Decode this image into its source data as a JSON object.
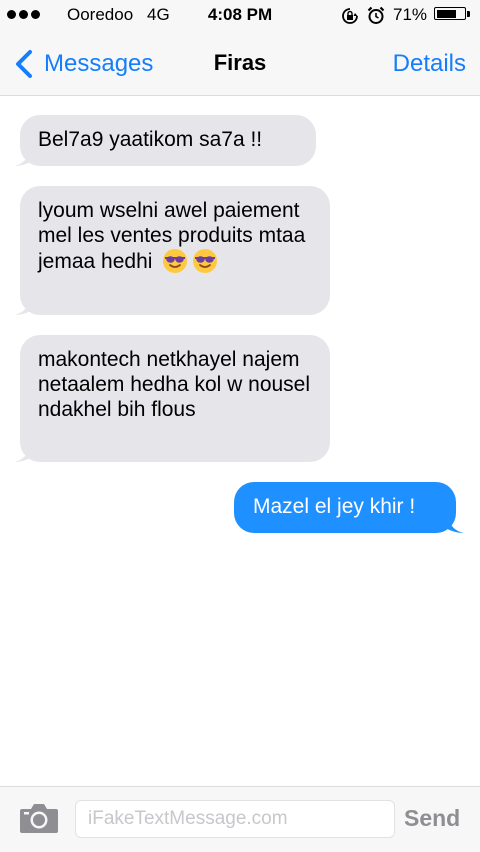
{
  "status_bar": {
    "carrier": "Ooredoo",
    "network": "4G",
    "time": "4:08 PM",
    "battery_percent_text": "71%",
    "battery_level": 0.71,
    "signal_dots": 3
  },
  "nav": {
    "back_label": "Messages",
    "title": "Firas",
    "details_label": "Details"
  },
  "messages": [
    {
      "direction": "incoming",
      "text": "Bel7a9 yaatikom sa7a !!"
    },
    {
      "direction": "incoming",
      "text": "lyoum wselni awel paiement mel les ventes produits mtaa jemaa hedhi",
      "emoji": "smiling-face-with-sunglasses-icon",
      "emoji_count": 2
    },
    {
      "direction": "incoming",
      "text": "makontech netkhayel najem netaalem hedha kol w nousel ndakhel bih flous"
    },
    {
      "direction": "outgoing",
      "text": "Mazel el jey khir !"
    }
  ],
  "input_bar": {
    "placeholder": "iFakeTextMessage.com",
    "send_label": "Send"
  },
  "colors": {
    "accent": "#147efb",
    "incoming_bubble": "#e5e5ea",
    "outgoing_bubble": "#1e90ff",
    "bar_background": "#f7f7f7"
  }
}
